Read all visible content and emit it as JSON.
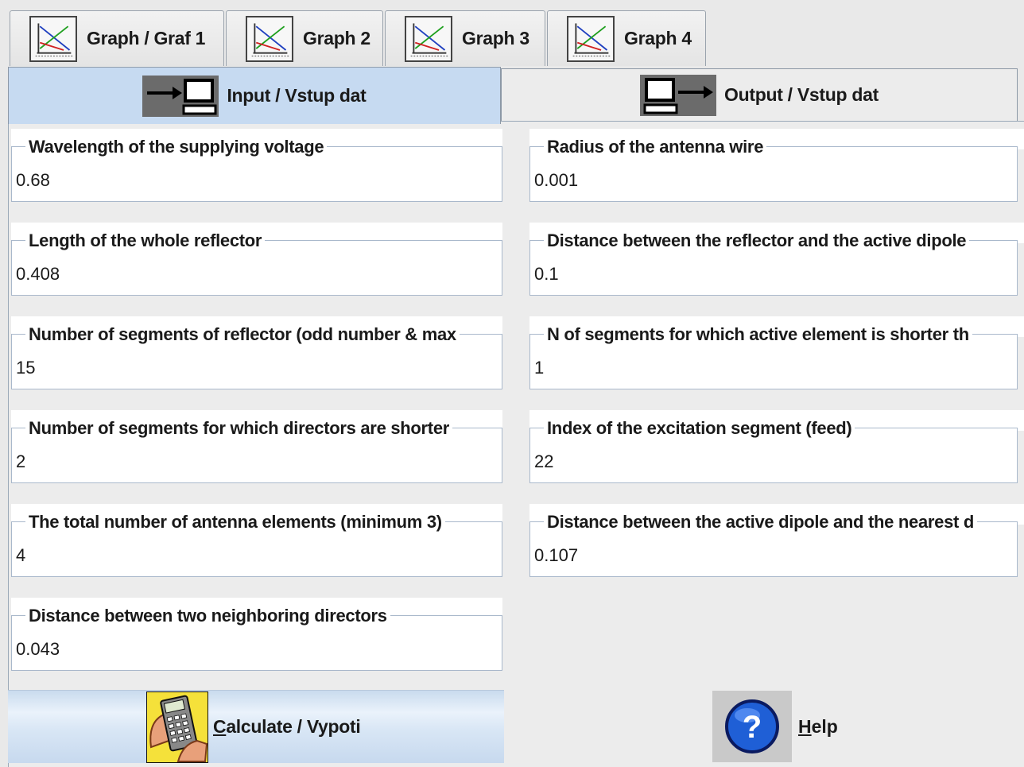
{
  "graph_tabs": [
    {
      "label": "Graph / Graf 1"
    },
    {
      "label": "Graph 2"
    },
    {
      "label": "Graph 3"
    },
    {
      "label": "Graph 4"
    }
  ],
  "io_tabs": {
    "input": {
      "label": "Input / Vstup dat",
      "active": true
    },
    "output": {
      "label": "Output / Vstup dat",
      "active": false
    }
  },
  "left_fields": [
    {
      "label": "Wavelength of the supplying voltage",
      "value": "0.68"
    },
    {
      "label": "Length of the whole reflector",
      "value": "0.408"
    },
    {
      "label": "Number of segments of reflector (odd number & max",
      "value": "15"
    },
    {
      "label": "Number of segments for which directors are shorter",
      "value": "2"
    },
    {
      "label": "The total number of antenna elements (minimum 3)",
      "value": "4"
    },
    {
      "label": "Distance between two neighboring directors",
      "value": "0.043"
    }
  ],
  "right_fields": [
    {
      "label": "Radius of the antenna wire",
      "value": "0.001"
    },
    {
      "label": "Distance between the reflector and the active dipole",
      "value": "0.1"
    },
    {
      "label": "N of segments for which active element is shorter th",
      "value": "1"
    },
    {
      "label": "Index of the excitation segment (feed)",
      "value": "22"
    },
    {
      "label": "Distance between the active dipole and the nearest d",
      "value": "0.107"
    }
  ],
  "buttons": {
    "calculate": {
      "mnemonic": "C",
      "rest": "alculate / Vypoti",
      "icon": "calculator-icon"
    },
    "help": {
      "mnemonic": "H",
      "rest": "elp",
      "icon": "help-icon"
    }
  },
  "colors": {
    "active_tab": "#c6daf1",
    "panel_bg": "#ececec",
    "field_border": "#a9b8cb",
    "calc_button": "#d8e6f5",
    "help_blue": "#1f5fd6"
  }
}
